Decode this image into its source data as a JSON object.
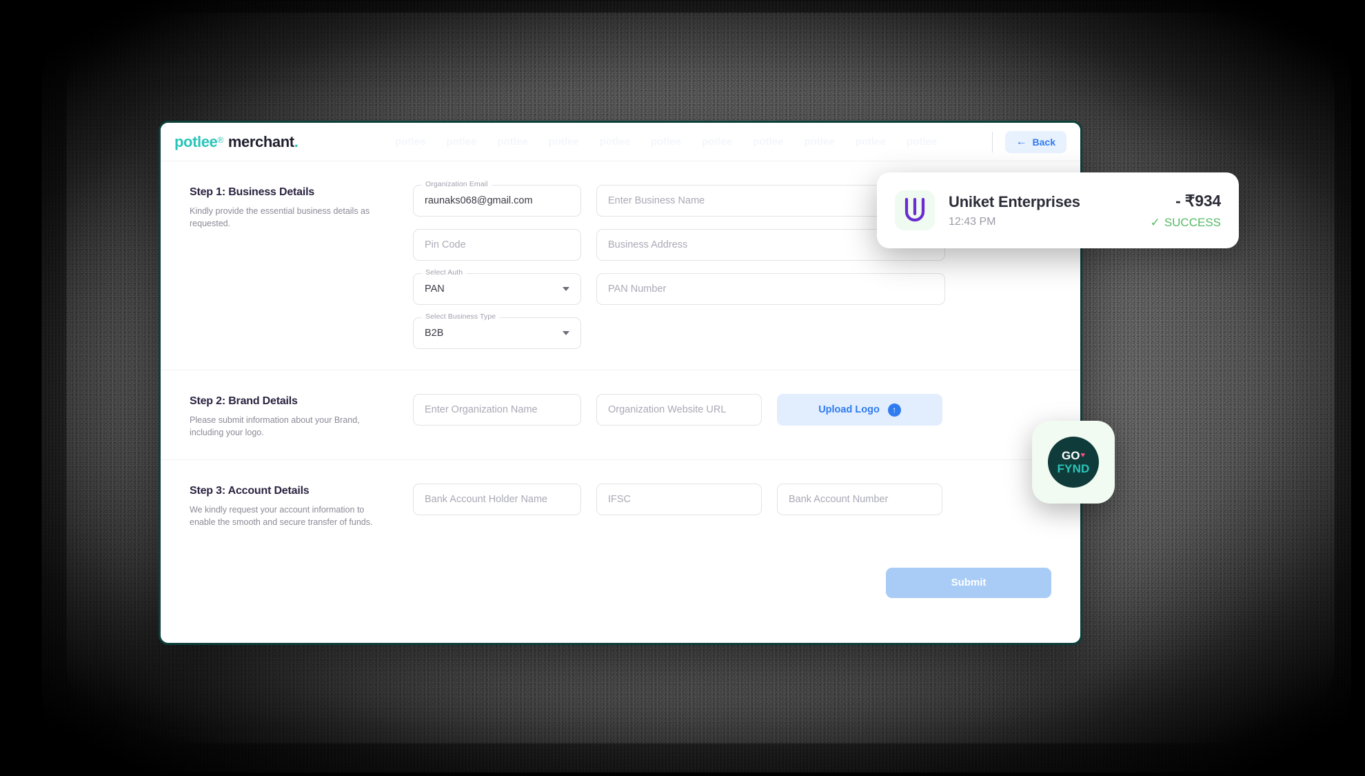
{
  "header": {
    "brand_primary": "potlee",
    "brand_reg": "®",
    "brand_secondary": "merchant",
    "brand_dot": ".",
    "watermark_text": "potlee",
    "back_label": "Back",
    "back_arrow": "←"
  },
  "steps": [
    {
      "title": "Step 1: Business Details",
      "desc": "Kindly provide the essential business details as requested.",
      "fields": [
        {
          "name": "organization-email",
          "label": "Organization Email",
          "value": "raunaks068@gmail.com",
          "placeholder": "",
          "type": "text",
          "width": "w-m"
        },
        {
          "name": "business-name",
          "label": "",
          "value": "",
          "placeholder": "Enter Business Name",
          "type": "text",
          "width": "w-l"
        },
        {
          "name": "pin-code",
          "label": "",
          "value": "",
          "placeholder": "Pin Code",
          "type": "text",
          "width": "w-m"
        },
        {
          "name": "business-address",
          "label": "",
          "value": "",
          "placeholder": "Business Address",
          "type": "text",
          "width": "w-l"
        },
        {
          "name": "select-auth",
          "label": "Select Auth",
          "value": "PAN",
          "placeholder": "",
          "type": "select",
          "width": "w-m"
        },
        {
          "name": "pan-number",
          "label": "",
          "value": "",
          "placeholder": "PAN Number",
          "type": "text",
          "width": "w-l"
        },
        {
          "name": "select-business-type",
          "label": "Select Business Type",
          "value": "B2B",
          "placeholder": "",
          "type": "select",
          "width": "w-m"
        }
      ]
    },
    {
      "title": "Step 2: Brand Details",
      "desc": "Please submit information about your Brand, including your logo.",
      "fields": [
        {
          "name": "organization-name",
          "label": "",
          "value": "",
          "placeholder": "Enter Organization Name",
          "type": "text",
          "width": "w-m"
        },
        {
          "name": "organization-website-url",
          "label": "",
          "value": "",
          "placeholder": "Organization Website URL",
          "type": "text",
          "width": "w-xl"
        },
        {
          "name": "upload-logo",
          "label": "",
          "value": "Upload Logo",
          "placeholder": "",
          "type": "upload",
          "width": "w-xl"
        }
      ]
    },
    {
      "title": "Step 3: Account Details",
      "desc": "We kindly request your account information to enable the smooth and secure transfer of funds.",
      "fields": [
        {
          "name": "bank-account-holder-name",
          "label": "",
          "value": "",
          "placeholder": "Bank Account Holder Name",
          "type": "text",
          "width": "w-m"
        },
        {
          "name": "ifsc",
          "label": "",
          "value": "",
          "placeholder": "IFSC",
          "type": "text",
          "width": "w-xl"
        },
        {
          "name": "bank-account-number",
          "label": "",
          "value": "",
          "placeholder": "Bank Account Number",
          "type": "text",
          "width": "w-xl"
        }
      ]
    }
  ],
  "submit": {
    "label": "Submit"
  },
  "toast": {
    "merchant_name": "Uniket Enterprises",
    "time": "12:43 PM",
    "amount": "- ₹934",
    "status": "SUCCESS",
    "status_check": "✓",
    "logo_alt": "uniket-logo"
  },
  "gofynd_badge": {
    "go_text": "GO",
    "heart": "♥",
    "fynd_text": "FYND"
  },
  "colors": {
    "brand_teal": "#2bc4b8",
    "window_border": "#0b3f3a",
    "accent_blue": "#2f7bf0",
    "submit_blue": "#a8ccf6",
    "success_green": "#55b964",
    "uniket_purple": "#6a2bd0"
  }
}
